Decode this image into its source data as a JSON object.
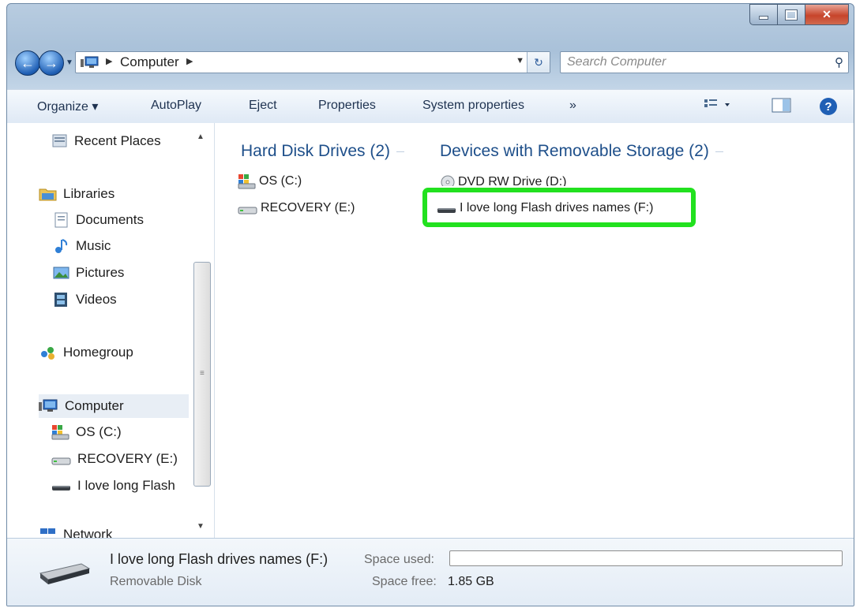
{
  "window": {
    "address": {
      "crumb": "Computer"
    },
    "search": {
      "placeholder": "Search Computer"
    }
  },
  "toolbar": {
    "organize": "Organize",
    "autoplay": "AutoPlay",
    "eject": "Eject",
    "properties": "Properties",
    "system_properties": "System properties",
    "more": "»"
  },
  "sidebar": {
    "items": [
      {
        "label": "Recent Places",
        "icon": "recent-places-icon"
      },
      {
        "label": "Libraries",
        "icon": "libraries-icon"
      },
      {
        "label": "Documents",
        "icon": "documents-icon"
      },
      {
        "label": "Music",
        "icon": "music-icon"
      },
      {
        "label": "Pictures",
        "icon": "pictures-icon"
      },
      {
        "label": "Videos",
        "icon": "videos-icon"
      },
      {
        "label": "Homegroup",
        "icon": "homegroup-icon"
      },
      {
        "label": "Computer",
        "icon": "computer-icon"
      },
      {
        "label": "OS (C:)",
        "icon": "os-drive-icon"
      },
      {
        "label": "RECOVERY (E:)",
        "icon": "hard-drive-icon"
      },
      {
        "label": "I love long Flash",
        "icon": "usb-drive-icon"
      },
      {
        "label": "Network",
        "icon": "network-icon"
      }
    ]
  },
  "main": {
    "hdd_group": "Hard Disk Drives (2)",
    "removable_group": "Devices with Removable Storage (2)",
    "drives": [
      {
        "label": "OS (C:)",
        "icon": "os-drive-icon"
      },
      {
        "label": "RECOVERY (E:)",
        "icon": "hard-drive-icon"
      },
      {
        "label": "DVD RW Drive (D:)",
        "icon": "dvd-drive-icon"
      },
      {
        "label": "I love long Flash drives names (F:)",
        "icon": "usb-drive-icon"
      }
    ],
    "highlight_color": "#22e11f"
  },
  "details": {
    "name": "I love long Flash drives names (F:)",
    "type": "Removable Disk",
    "space_used_label": "Space used:",
    "space_used_fraction": 0,
    "space_free_label": "Space free:",
    "space_free_value": "1.85 GB"
  }
}
